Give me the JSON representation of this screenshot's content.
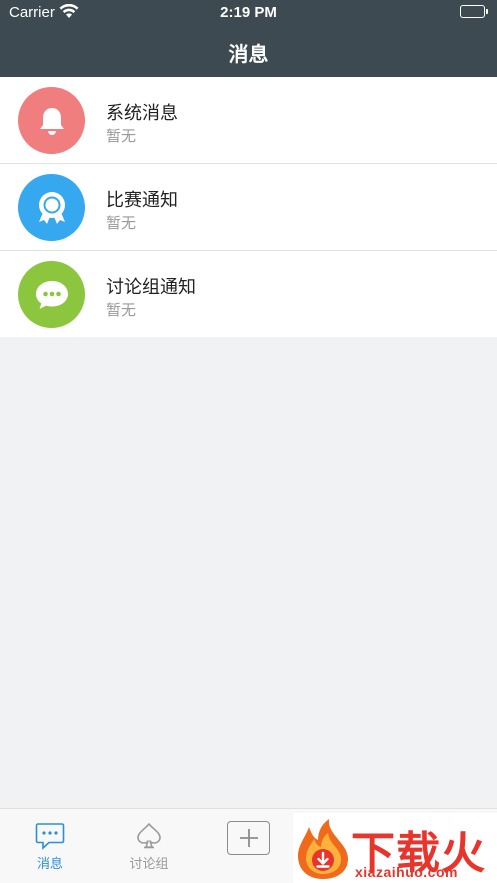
{
  "status_bar": {
    "carrier": "Carrier",
    "time": "2:19 PM"
  },
  "nav": {
    "title": "消息"
  },
  "messages": [
    {
      "title": "系统消息",
      "subtitle": "暂无",
      "icon": "bell-icon",
      "color": "#f07e7e"
    },
    {
      "title": "比赛通知",
      "subtitle": "暂无",
      "icon": "award-badge-icon",
      "color": "#35a8ef"
    },
    {
      "title": "讨论组通知",
      "subtitle": "暂无",
      "icon": "chat-bubble-icon",
      "color": "#8cc63f"
    }
  ],
  "tabbar": {
    "items": [
      {
        "label": "消息",
        "icon": "message-icon",
        "active": true
      },
      {
        "label": "讨论组",
        "icon": "spade-icon",
        "active": false
      },
      {
        "label": "",
        "icon": "plus-icon",
        "active": false
      }
    ],
    "active_color": "#2a8fd8",
    "inactive_color": "#999999"
  },
  "watermark": {
    "cn": "下载火",
    "en": "xiazaihuo.com",
    "color": "#e8342a"
  }
}
